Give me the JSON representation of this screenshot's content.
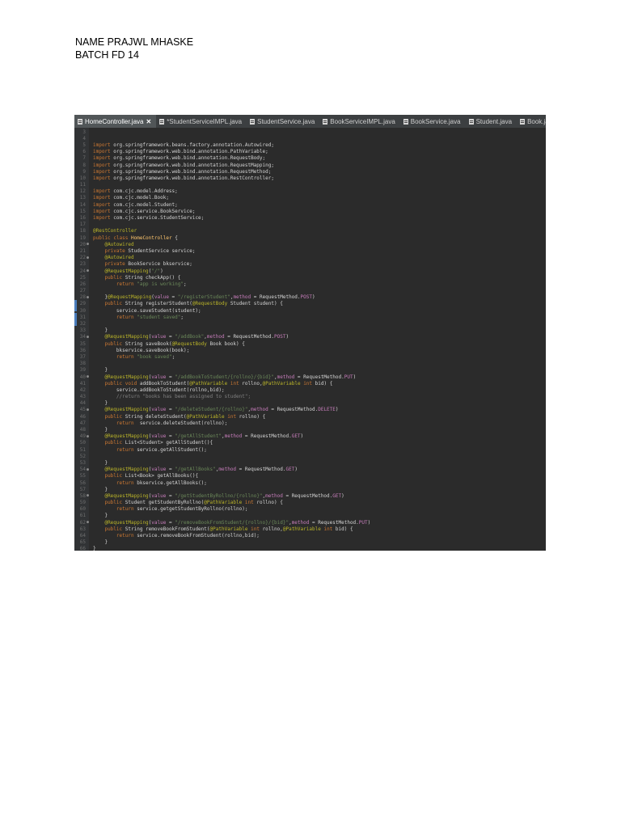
{
  "header": {
    "line1": "NAME PRAJWL MHASKE",
    "line2": "BATCH FD 14"
  },
  "editor": {
    "tabs": [
      {
        "label": "HomeController.java",
        "active": true,
        "icon": "java-file-icon"
      },
      {
        "label": "*StudentServiceIMPL.java",
        "active": false,
        "icon": "java-file-icon"
      },
      {
        "label": "StudentService.java",
        "active": false,
        "icon": "java-file-icon"
      },
      {
        "label": "BookServiceIMPL.java",
        "active": false,
        "icon": "java-file-icon"
      },
      {
        "label": "BookService.java",
        "active": false,
        "icon": "java-file-icon"
      },
      {
        "label": "Student.java",
        "active": false,
        "icon": "java-file-icon"
      },
      {
        "label": "Book.java",
        "active": false,
        "icon": "java-file-icon"
      }
    ],
    "close_glyph": "✕",
    "lines": [
      {
        "n": "3",
        "t": ""
      },
      {
        "n": "4",
        "t": ""
      },
      {
        "n": "5",
        "t": "import org.springframework.beans.factory.annotation.Autowired;"
      },
      {
        "n": "6",
        "t": "import org.springframework.web.bind.annotation.PathVariable;"
      },
      {
        "n": "7",
        "t": "import org.springframework.web.bind.annotation.RequestBody;"
      },
      {
        "n": "8",
        "t": "import org.springframework.web.bind.annotation.RequestMapping;"
      },
      {
        "n": "9",
        "t": "import org.springframework.web.bind.annotation.RequestMethod;"
      },
      {
        "n": "10",
        "t": "import org.springframework.web.bind.annotation.RestController;"
      },
      {
        "n": "11",
        "t": ""
      },
      {
        "n": "12",
        "t": "import com.cjc.model.Address;"
      },
      {
        "n": "13",
        "t": "import com.cjc.model.Book;"
      },
      {
        "n": "14",
        "t": "import com.cjc.model.Student;"
      },
      {
        "n": "15",
        "t": "import com.cjc.service.BookService;"
      },
      {
        "n": "16",
        "t": "import com.cjc.service.StudentService;"
      },
      {
        "n": "17",
        "t": ""
      },
      {
        "n": "18",
        "t": "@RestController"
      },
      {
        "n": "19",
        "t": "public class HomeController {"
      },
      {
        "n": "20",
        "t": "    @Autowired"
      },
      {
        "n": "21",
        "t": "    private StudentService service;"
      },
      {
        "n": "22",
        "t": "    @Autowired"
      },
      {
        "n": "23",
        "t": "    private BookService bkservice;"
      },
      {
        "n": "24",
        "t": "    @RequestMapping(\"/\")"
      },
      {
        "n": "25",
        "t": "    public String checkApp() {"
      },
      {
        "n": "26",
        "t": "        return \"app is working\";"
      },
      {
        "n": "27",
        "t": ""
      },
      {
        "n": "28",
        "t": "    }@RequestMapping(value = \"/registerStudent\",method = RequestMethod.POST)"
      },
      {
        "n": "29",
        "t": "    public String registerStudent(@RequestBody Student student) {"
      },
      {
        "n": "30",
        "t": "        service.saveStudent(student);"
      },
      {
        "n": "31",
        "t": "        return \"student saved\";"
      },
      {
        "n": "32",
        "t": ""
      },
      {
        "n": "33",
        "t": "    }"
      },
      {
        "n": "34",
        "t": "    @RequestMapping(value = \"/addBook\",method = RequestMethod.POST)"
      },
      {
        "n": "35",
        "t": "    public String saveBook(@RequestBody Book book) {"
      },
      {
        "n": "36",
        "t": "        bkservice.saveBook(book);"
      },
      {
        "n": "37",
        "t": "        return \"book saved\";"
      },
      {
        "n": "38",
        "t": ""
      },
      {
        "n": "39",
        "t": "    }"
      },
      {
        "n": "40",
        "t": "    @RequestMapping(value = \"/addBookToStudent/{rollno}/{bid}\",method = RequestMethod.PUT)"
      },
      {
        "n": "41",
        "t": "    public void addBookToStudent(@PathVariable int rollno,@PathVariable int bid) {"
      },
      {
        "n": "42",
        "t": "        service.addBookToStudent(rollno,bid);"
      },
      {
        "n": "43",
        "t": "        //return \"books has been assigned to student\";"
      },
      {
        "n": "44",
        "t": "    }"
      },
      {
        "n": "45",
        "t": "    @RequestMapping(value = \"/deleteStudent/{rollno}\",method = RequestMethod.DELETE)"
      },
      {
        "n": "46",
        "t": "    public String deleteStudent(@PathVariable int rollno) {"
      },
      {
        "n": "47",
        "t": "        return  service.deleteStudent(rollno);"
      },
      {
        "n": "48",
        "t": "    }"
      },
      {
        "n": "49",
        "t": "    @RequestMapping(value = \"/getAllStudent\",method = RequestMethod.GET)"
      },
      {
        "n": "50",
        "t": "    public List<Student> getAllStudent(){"
      },
      {
        "n": "51",
        "t": "        return service.getAllStudent();"
      },
      {
        "n": "52",
        "t": ""
      },
      {
        "n": "53",
        "t": "    }"
      },
      {
        "n": "54",
        "t": "    @RequestMapping(value = \"/getAllBooks\",method = RequestMethod.GET)"
      },
      {
        "n": "55",
        "t": "    public List<Book> getAllBooks(){"
      },
      {
        "n": "56",
        "t": "        return bkservice.getAllBooks();"
      },
      {
        "n": "57",
        "t": "    }"
      },
      {
        "n": "58",
        "t": "    @RequestMapping(value = \"/getStudentByRollno/{rollno}\",method = RequestMethod.GET)"
      },
      {
        "n": "59",
        "t": "    public Student getStudentByRollno(@PathVariable int rollno) {"
      },
      {
        "n": "60",
        "t": "        return service.getgetStudentByRollno(rollno);"
      },
      {
        "n": "61",
        "t": "    }"
      },
      {
        "n": "62",
        "t": "    @RequestMapping(value = \"/removeBookFromStudent/{rollno}/{bid}\",method = RequestMethod.PUT)"
      },
      {
        "n": "63",
        "t": "    public String removeBookFromStudent(@PathVariable int rollno,@PathVariable int bid) {"
      },
      {
        "n": "64",
        "t": "        return service.removeBookFromStudent(rollno,bid);"
      },
      {
        "n": "65",
        "t": "    }"
      },
      {
        "n": "66",
        "t": "}"
      },
      {
        "n": "67",
        "t": ""
      }
    ]
  }
}
